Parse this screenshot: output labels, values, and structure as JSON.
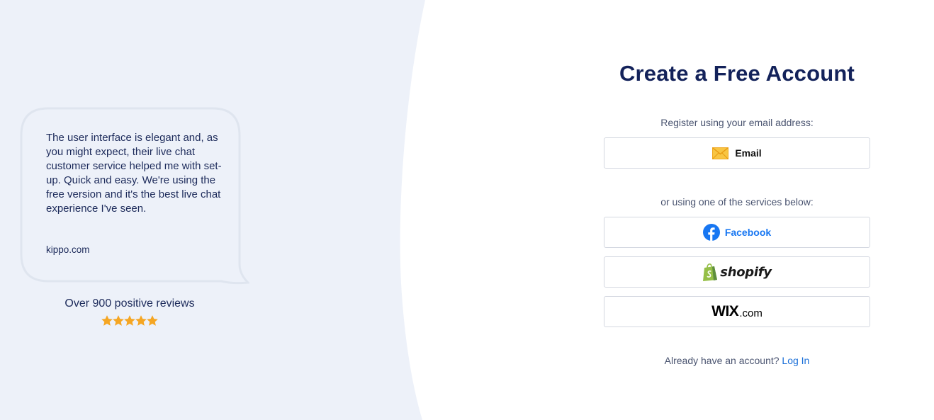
{
  "testimonial": {
    "quote": "The user interface is elegant and, as you might expect, their live chat customer service helped me with set-up. Quick and easy. We're using the free version and it's the best live chat experience I've seen.",
    "source": "kippo.com"
  },
  "reviews": {
    "text": "Over 900 positive reviews",
    "rating": 5,
    "star_color": "#f5a623"
  },
  "signup": {
    "title": "Create a Free Account",
    "email_prompt": "Register using your email address:",
    "email_button_label": "Email",
    "services_prompt": "or using one of the services below:",
    "facebook_label": "Facebook",
    "shopify_label": "shopify",
    "wix_label": "WIX",
    "wix_suffix": ".com",
    "login_prompt": "Already have an account?",
    "login_link": "Log In"
  },
  "icons": {
    "email": "envelope-icon",
    "facebook": "facebook-icon",
    "shopify": "shopify-bag-icon",
    "star": "star-icon"
  },
  "colors": {
    "left_background": "#edf1f9",
    "title": "#13225a",
    "link": "#1a6fd8",
    "facebook": "#1877f2",
    "shopify": "#95bf47",
    "email_icon": "#f5b321"
  }
}
